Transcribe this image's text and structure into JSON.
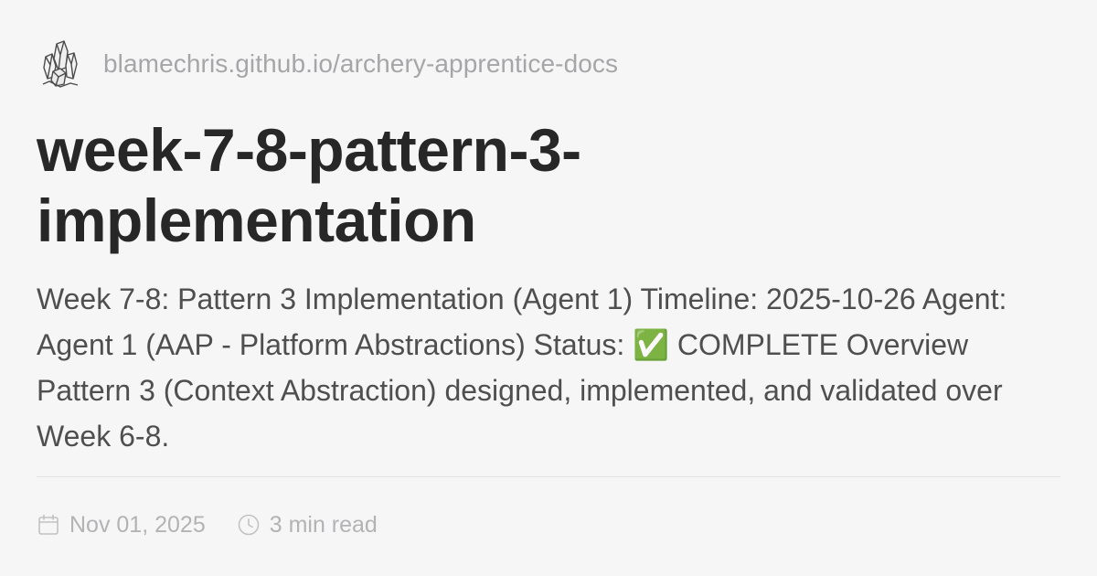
{
  "site": {
    "logo_icon": "crystal-cluster-icon",
    "url": "blamechris.github.io/archery-apprentice-docs"
  },
  "title_line_1": "week-7-8-pattern-3-",
  "title_line_2": "implementation",
  "description": "Week 7-8: Pattern 3 Implementation (Agent 1) Timeline: 2025-10-26 Agent: Agent 1 (AAP - Platform Abstractions) Status: ✅ COMPLETE Overview Pattern 3 (Context Abstraction) designed, implemented, and validated over Week 6-8.",
  "meta": {
    "date_icon": "calendar-icon",
    "date": "Nov 01, 2025",
    "read_icon": "clock-icon",
    "read_time": "3 min read"
  },
  "colors": {
    "background": "#f7f6f7",
    "title": "#272727",
    "body": "#4f4f4f",
    "muted": "#a6a6a8"
  }
}
